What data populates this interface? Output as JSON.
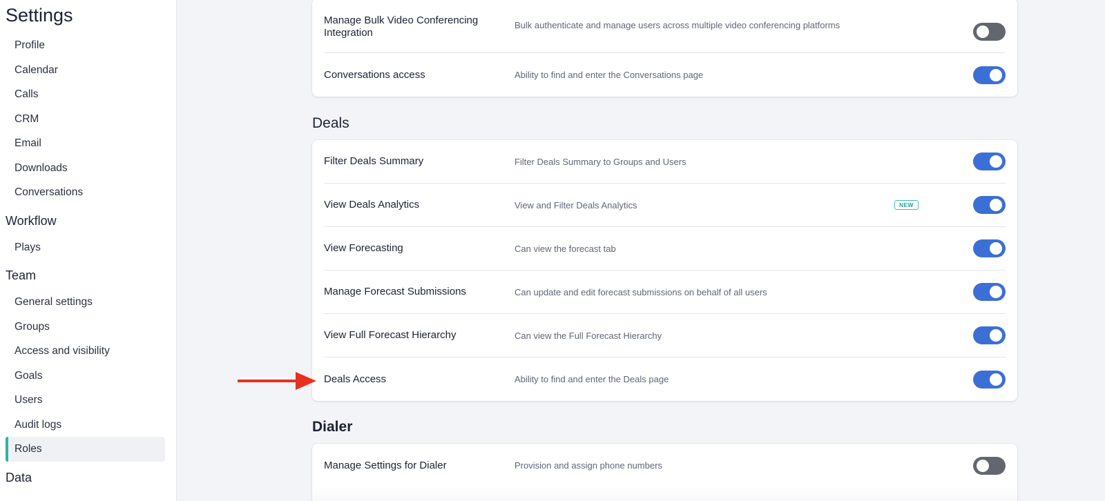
{
  "sidebar": {
    "title": "Settings",
    "groups": [
      {
        "items": [
          "Profile",
          "Calendar",
          "Calls",
          "CRM",
          "Email",
          "Downloads",
          "Conversations"
        ]
      },
      {
        "title": "Workflow",
        "items": [
          "Plays"
        ]
      },
      {
        "title": "Team",
        "items": [
          "General settings",
          "Groups",
          "Access and visibility",
          "Goals",
          "Users",
          "Audit logs",
          "Roles"
        ]
      },
      {
        "title": "Data"
      }
    ],
    "active_item": "Roles"
  },
  "sections": {
    "top": {
      "rows": [
        {
          "name": "Manage Bulk Video Conferencing Integration",
          "desc": "Bulk authenticate and manage users across multiple video conferencing platforms",
          "enabled": false
        },
        {
          "name": "Conversations access",
          "desc": "Ability to find and enter the Conversations page",
          "enabled": true
        }
      ]
    },
    "deals": {
      "title": "Deals",
      "rows": [
        {
          "name": "Filter Deals Summary",
          "desc": "Filter Deals Summary to Groups and Users",
          "enabled": true
        },
        {
          "name": "View Deals Analytics",
          "desc": "View and Filter Deals Analytics",
          "badge": "NEW",
          "enabled": true
        },
        {
          "name": "View Forecasting",
          "desc": "Can view the forecast tab",
          "enabled": true
        },
        {
          "name": "Manage Forecast Submissions",
          "desc": "Can update and edit forecast submissions on behalf of all users",
          "enabled": true
        },
        {
          "name": "View Full Forecast Hierarchy",
          "desc": "Can view the Full Forecast Hierarchy",
          "enabled": true
        },
        {
          "name": "Deals Access",
          "desc": "Ability to find and enter the Deals page",
          "enabled": true
        }
      ]
    },
    "dialer": {
      "title": "Dialer",
      "rows": [
        {
          "name": "Manage Settings for Dialer",
          "desc": "Provision and assign phone numbers",
          "enabled": false
        }
      ]
    }
  },
  "annotation": {
    "arrow_color": "#e8301f",
    "arrow_icon": "right-arrow-icon"
  },
  "colors": {
    "toggle_on": "#3c6fd6",
    "toggle_off": "#62666f",
    "active_accent": "#2fb3a6",
    "badge": "#23a597"
  }
}
